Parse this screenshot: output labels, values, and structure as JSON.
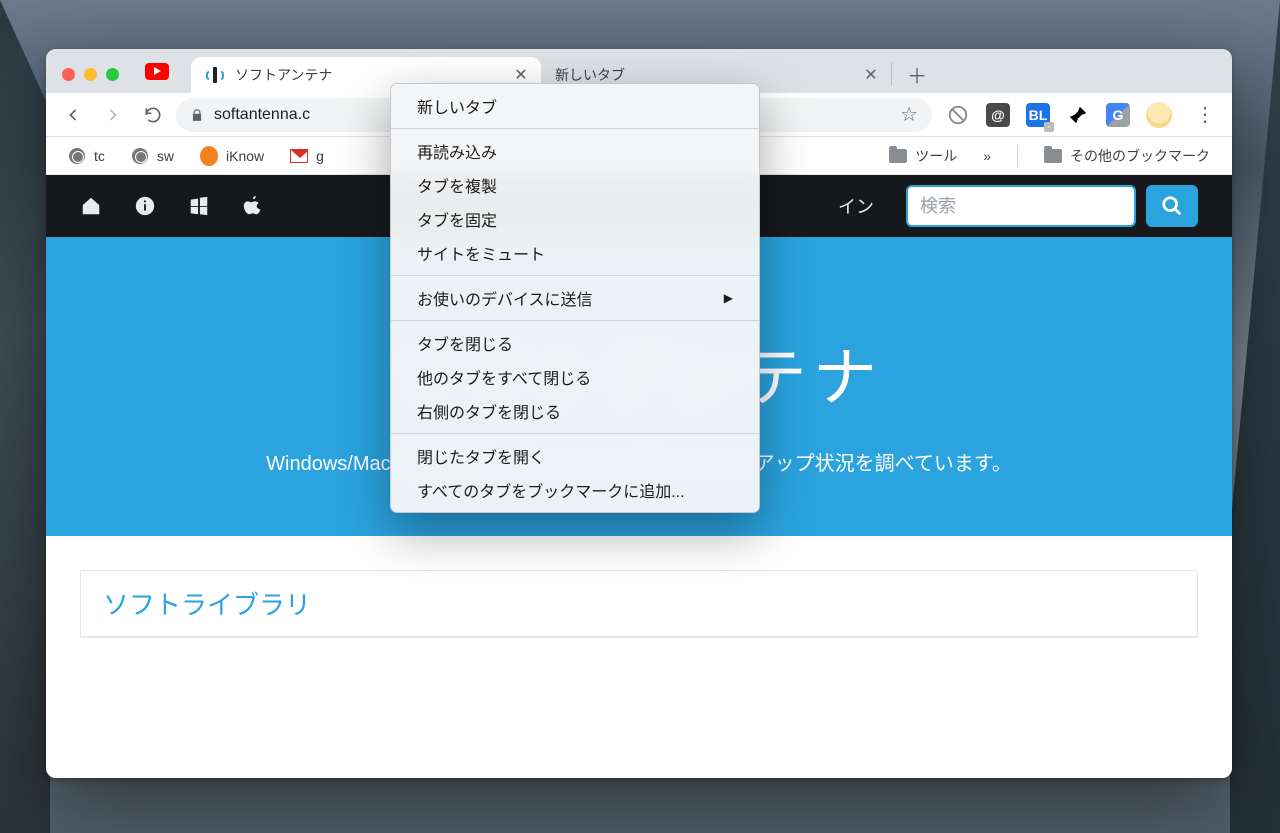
{
  "browser": {
    "tabs": [
      {
        "title": "ソフトアンテナ",
        "active": true
      },
      {
        "title": "新しいタブ",
        "active": false
      }
    ],
    "url": "softantenna.c",
    "bookmarks": {
      "items": [
        {
          "label": "tc",
          "icon": "globe"
        },
        {
          "label": "sw",
          "icon": "globe"
        },
        {
          "label": "iKnow",
          "icon": "owl"
        },
        {
          "label": "g",
          "icon": "gmail"
        }
      ],
      "tool_folder": "ツール",
      "overflow": "»",
      "other": "その他のブックマーク"
    }
  },
  "context_menu": {
    "groups": [
      [
        "新しいタブ"
      ],
      [
        "再読み込み",
        "タブを複製",
        "タブを固定",
        "サイトをミュート"
      ],
      [
        {
          "label": "お使いのデバイスに送信",
          "submenu": true
        }
      ],
      [
        "タブを閉じる",
        "他のタブをすべて閉じる",
        "右側のタブを閉じる"
      ],
      [
        "閉じたタブを開く",
        "すべてのタブをブックマークに追加..."
      ]
    ]
  },
  "site": {
    "nav_login": "イン",
    "search_placeholder": "検索",
    "hero_title": "ソフトアンテナ",
    "hero_sub": "Windows/Mac/Mobile用オンラインソフトのバージョンアップ状況を調べています。",
    "panel_title": "ソフトライブラリ"
  }
}
